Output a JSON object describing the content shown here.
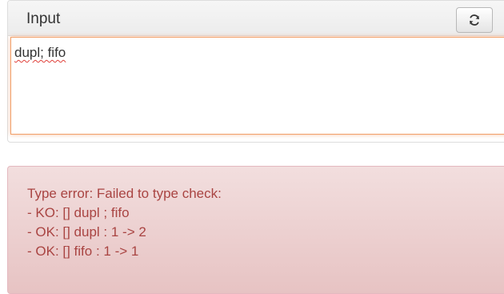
{
  "panel": {
    "title": "Input",
    "refresh_icon": "refresh-icon"
  },
  "input": {
    "value": "dupl; fifo"
  },
  "error": {
    "lines": [
      "Type error: Failed to type check:",
      "- KO: [] dupl ; fifo",
      "- OK: [] dupl : 1 -> 2",
      "- OK: [] fifo : 1 -> 1"
    ]
  }
}
